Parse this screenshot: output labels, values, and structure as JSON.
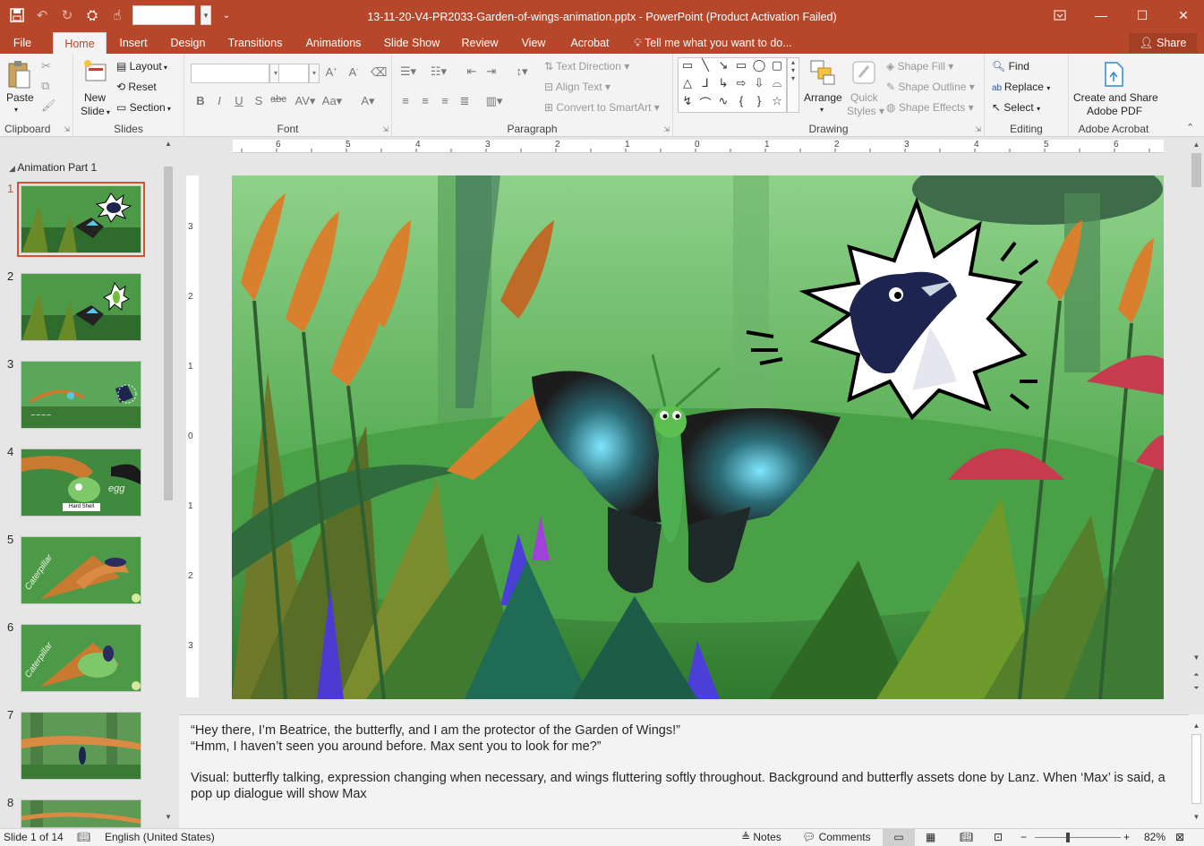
{
  "app": {
    "window_title": "13-11-20-V4-PR2033-Garden-of-wings-animation.pptx  -  PowerPoint (Product Activation Failed)",
    "share_label": "Share",
    "tell_me": "Tell me what you want to do..."
  },
  "tabs": [
    "File",
    "Home",
    "Insert",
    "Design",
    "Transitions",
    "Animations",
    "Slide Show",
    "Review",
    "View",
    "Acrobat"
  ],
  "active_tab": "Home",
  "ribbon": {
    "clipboard": {
      "label": "Clipboard",
      "paste": "Paste"
    },
    "slides": {
      "label": "Slides",
      "new_slide_1": "New",
      "new_slide_2": "Slide",
      "layout": "Layout",
      "reset": "Reset",
      "section": "Section"
    },
    "font": {
      "label": "Font"
    },
    "paragraph": {
      "label": "Paragraph",
      "text_direction": "Text Direction",
      "align_text": "Align Text",
      "convert_smartart": "Convert to SmartArt"
    },
    "drawing": {
      "label": "Drawing",
      "arrange": "Arrange",
      "quick_styles_1": "Quick",
      "quick_styles_2": "Styles",
      "shape_fill": "Shape Fill",
      "shape_outline": "Shape Outline",
      "shape_effects": "Shape Effects"
    },
    "editing": {
      "label": "Editing",
      "find": "Find",
      "replace": "Replace",
      "select": "Select"
    },
    "acrobat": {
      "label": "Adobe Acrobat",
      "create_1": "Create and Share",
      "create_2": "Adobe PDF"
    }
  },
  "thumbnails": {
    "section": "Animation Part 1",
    "numbers": [
      "1",
      "2",
      "3",
      "4",
      "5",
      "6",
      "7",
      "8"
    ],
    "selected": 1,
    "captions": {
      "t4": "Hard Shell",
      "t4b": "egg",
      "t5": "Caterpillar",
      "t6": "Caterpillar"
    }
  },
  "ruler": {
    "h": [
      "6",
      "5",
      "4",
      "3",
      "2",
      "1",
      "0",
      "1",
      "2",
      "3",
      "4",
      "5",
      "6"
    ],
    "v": [
      "3",
      "2",
      "1",
      "0",
      "1",
      "2",
      "3"
    ]
  },
  "notes": {
    "line1": "“Hey there, I’m Beatrice, the butterfly, and I am the protector of the Garden of Wings!”",
    "line2": "“Hmm, I haven’t seen you around before. Max sent you to look for me?”",
    "line3": "Visual: butterfly talking, expression changing when necessary, and wings fluttering softly throughout. Background and butterfly assets done by Lanz. When ‘Max’ is said, a pop up dialogue will show Max"
  },
  "status": {
    "slide": "Slide 1 of 14",
    "language": "English (United States)",
    "notes": "Notes",
    "comments": "Comments",
    "zoom": "82%"
  },
  "colors": {
    "accent": "#b7472a",
    "selection": "#d35230"
  }
}
